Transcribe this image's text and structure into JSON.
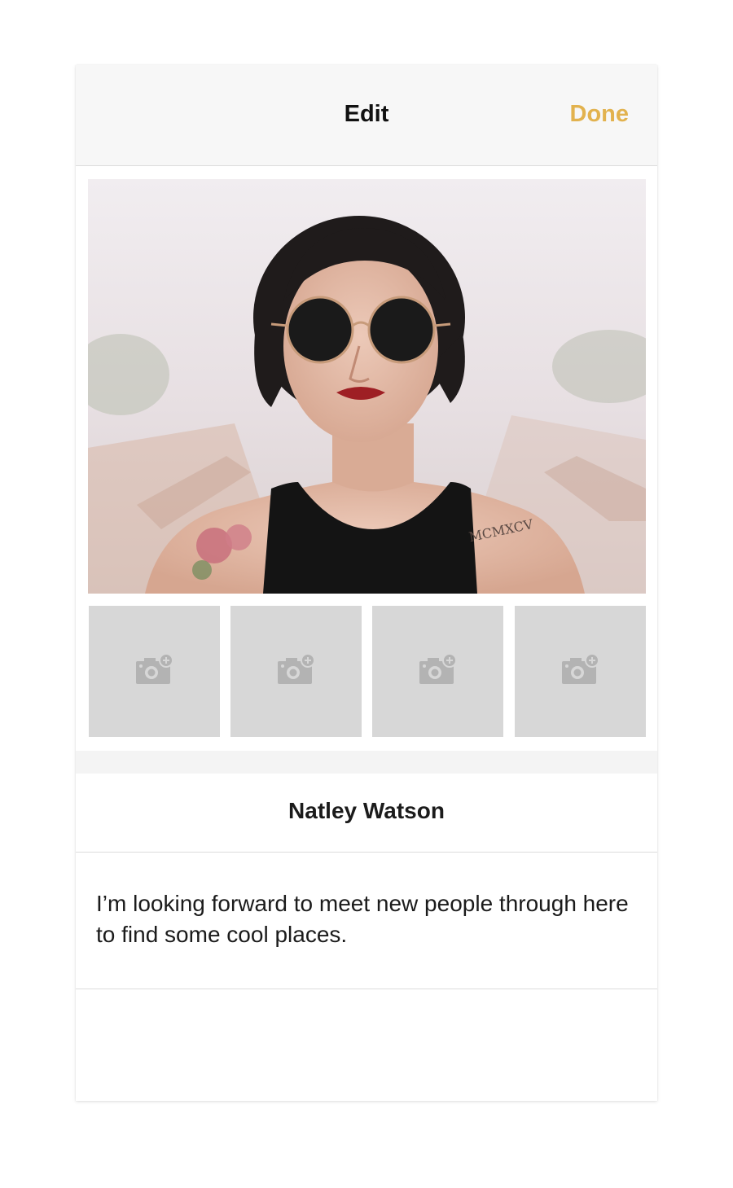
{
  "navbar": {
    "title": "Edit",
    "done_label": "Done",
    "done_color": "#e2b24e"
  },
  "photos": {
    "main_photo_alt": "profile-photo-woman-sunglasses",
    "slots": [
      {
        "icon": "add-photo-camera-icon"
      },
      {
        "icon": "add-photo-camera-icon"
      },
      {
        "icon": "add-photo-camera-icon"
      },
      {
        "icon": "add-photo-camera-icon"
      }
    ]
  },
  "profile": {
    "name": "Natley Watson",
    "bio": "I’m looking forward to meet new people through here to find some cool places."
  }
}
